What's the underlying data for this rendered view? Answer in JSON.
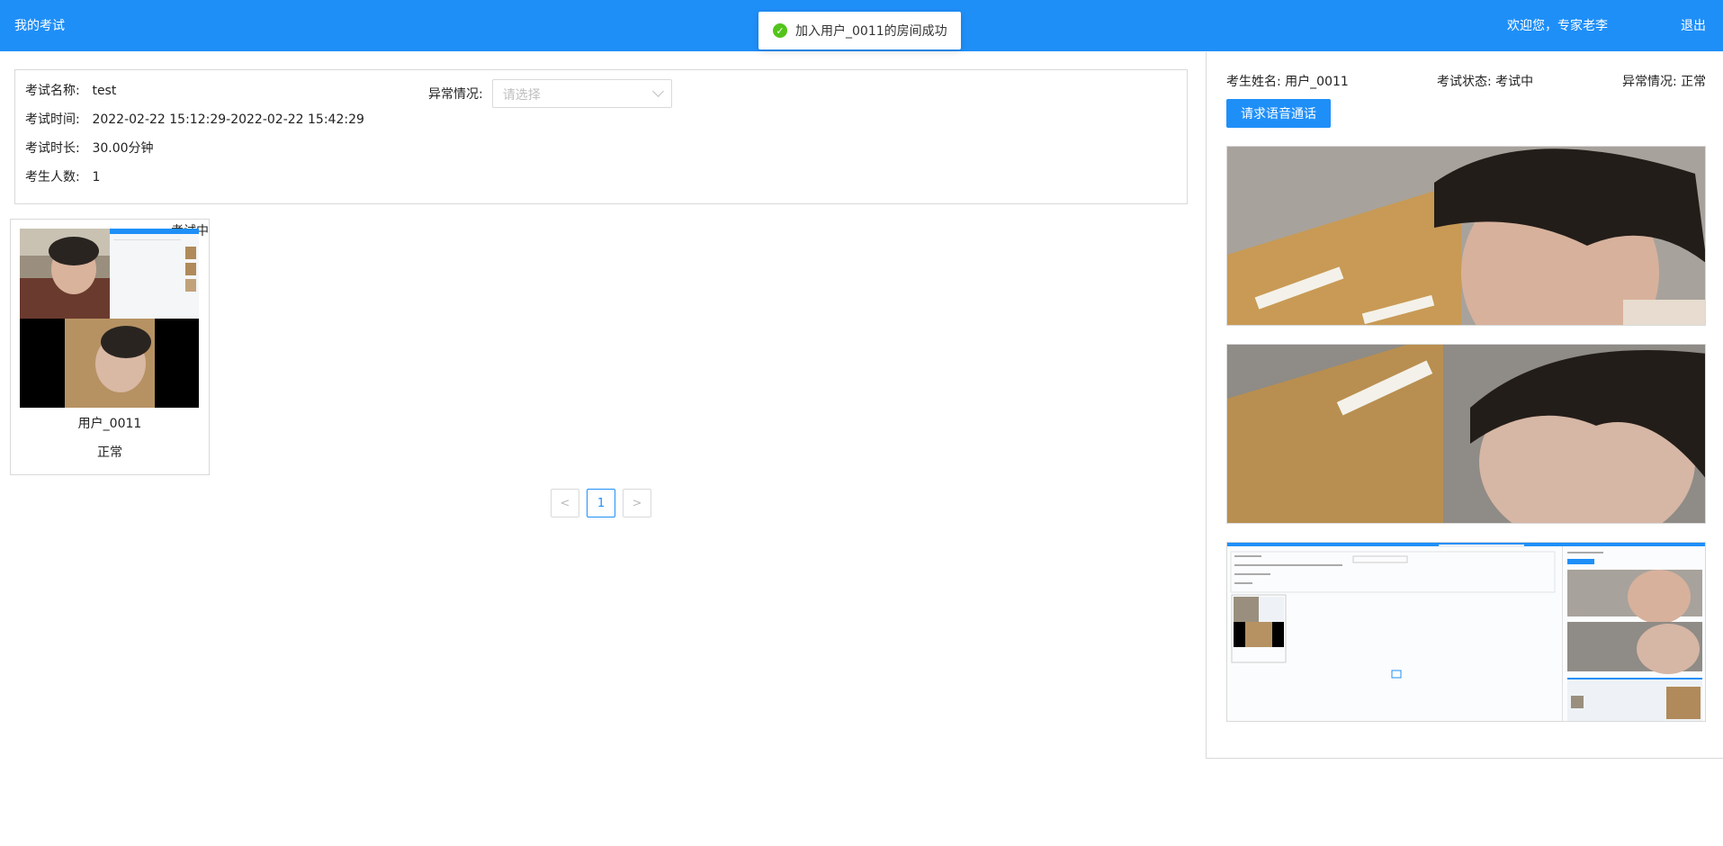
{
  "header": {
    "title": "我的考试",
    "welcome": "欢迎您，专家老李",
    "logout": "退出"
  },
  "toast": {
    "message": "加入用户_0011的房间成功",
    "icon": "check-circle-icon"
  },
  "exam_info": {
    "name_label": "考试名称:",
    "name_value": "test",
    "time_label": "考试时间:",
    "time_value": "2022-02-22 15:12:29-2022-02-22 15:42:29",
    "duration_label": "考试时长:",
    "duration_value": "30.00分钟",
    "count_label": "考生人数:",
    "count_value": "1",
    "abnormal_label": "异常情况:",
    "abnormal_placeholder": "请选择"
  },
  "student_card": {
    "status_badge": "考试中",
    "name": "用户_0011",
    "state": "正常"
  },
  "pagination": {
    "prev": "<",
    "current": "1",
    "next": ">"
  },
  "right_panel": {
    "student_name": "考生姓名: 用户_0011",
    "exam_status": "考试状态: 考试中",
    "abnormal": "异常情况: 正常",
    "call_button": "请求语音通话"
  }
}
